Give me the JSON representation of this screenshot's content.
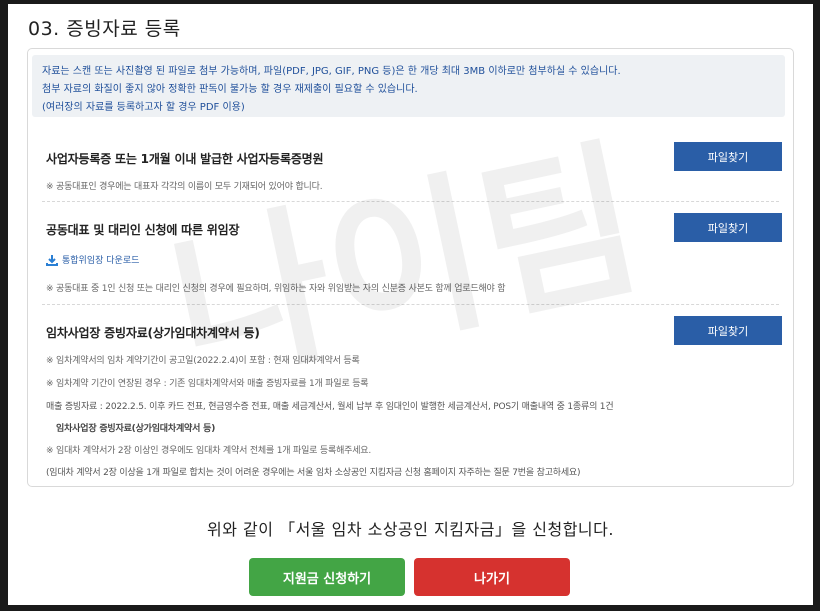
{
  "section": {
    "title": "03. 증빙자료 등록"
  },
  "notice": {
    "line1": "자료는 스캔 또는 사진촬영 된 파일로 첨부 가능하며, 파일(PDF, JPG, GIF, PNG 등)은 한 개당 최대 3MB 이하로만 첨부하실 수 있습니다.",
    "line2": "첨부 자료의 화질이 좋지 않아 정확한 판독이 불가능 할 경우 재제출이 필요할 수 있습니다.",
    "line3": "(여러장의 자료를 등록하고자 할 경우 PDF 이용)"
  },
  "items": [
    {
      "title": "사업자등록증 또는 1개월 이내 발급한 사업자등록증명원",
      "button": "파일찾기",
      "notes": [
        "※ 공동대표인 경우에는 대표자 각각의 이름이 모두 기재되어 있어야 합니다."
      ]
    },
    {
      "title": "공동대표 및 대리인 신청에 따른 위임장",
      "button": "파일찾기",
      "download": "통합위임장 다운로드",
      "notes": [
        "※ 공동대표 중 1인 신청 또는 대리인 신청의 경우에 필요하며, 위임하는 자와 위임받는 자의 신분증 사본도 함께 업로드해야 함"
      ]
    },
    {
      "title": "임차사업장 증빙자료(상가임대차계약서 등)",
      "button": "파일찾기",
      "notes": [
        "※ 임차계약서의 임차 계약기간이 공고일(2022.2.4)이 포함 : 현재 임대차계약서 등록",
        "※ 임차계약 기간이 연장된 경우 : 기존 임대차계약서와 매출 증빙자료를 1개 파일로 등록",
        "매출 증빙자료 : 2022.2.5. 이후 카드 전표, 현금영수증 전표, 매출 세금계산서, 월세 납부 후 임대인이 발행한 세금계산서, POS기 매출내역 중 1종류의 1건",
        "임차사업장 증빙자료(상가임대차계약서 등)",
        "※ 임대차 계약서가 2장 이상인 경우에도 임대차 계약서 전체를 1개 파일로 등록해주세요.",
        "(임대차 계약서 2장 이상을 1개 파일로 합치는 것이 어려운 경우에는 서울 임차 소상공인 지킴자금 신청 홈페이지 자주하는 질문 7번을 참고하세요)"
      ]
    }
  ],
  "watermark": "나이팀",
  "footer": {
    "agree_text": "위와 같이 「서울 임차 소상공인 지킴자금」을 신청합니다.",
    "submit": "지원금 신청하기",
    "exit": "나가기"
  },
  "colors": {
    "primary_blue": "#2a5ea7",
    "green": "#43a545",
    "red": "#d6322f",
    "notice_text": "#1f4f9a"
  }
}
